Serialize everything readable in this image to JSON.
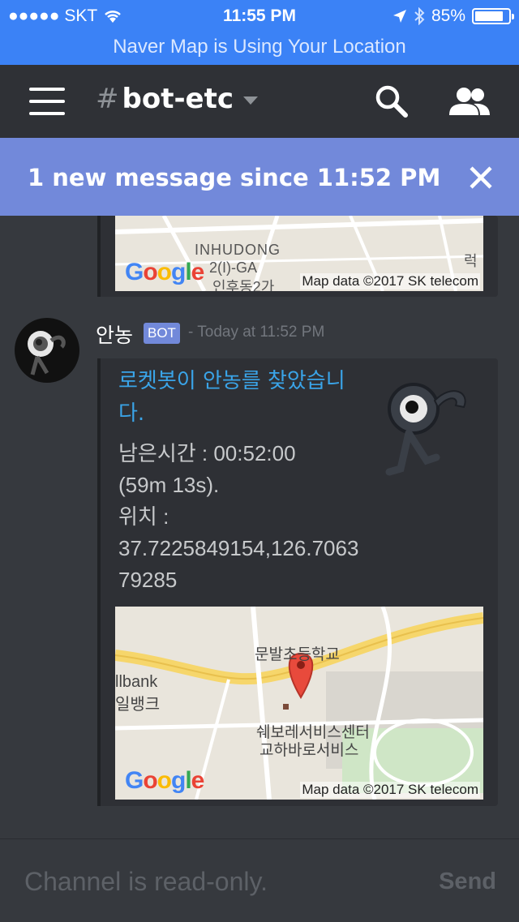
{
  "status_bar": {
    "carrier": "SKT",
    "time": "11:55 PM",
    "battery_percent": "85%",
    "battery_level": 0.85,
    "location_banner": "Naver Map is Using Your Location"
  },
  "header": {
    "channel_name": "bot-etc",
    "hash": "#"
  },
  "new_messages_bar": {
    "text": "1 new message since 11:52 PM"
  },
  "previous_embed": {
    "map_labels": [
      "INHUDONG",
      "2(I)-GA",
      "인후동2가",
      "럭"
    ],
    "google_logo": [
      "G",
      "o",
      "o",
      "g",
      "l",
      "e"
    ],
    "map_credit": "Map data ©2017 SK telecom"
  },
  "message": {
    "author": "안농",
    "badge": "BOT",
    "timestamp": "- Today at 11:52 PM",
    "embed": {
      "title": "로켓봇이 안농를 찾았습니다.",
      "description_lines": [
        "남은시간 : 00:52:00",
        "(59m 13s).",
        "위치 :",
        "37.7225849154,126.706379285"
      ],
      "map_labels": [
        "문발초등학교",
        "llbank",
        "일뱅크",
        "쉐보레서비스센터",
        "교하바로서비스"
      ],
      "google_logo": [
        "G",
        "o",
        "o",
        "g",
        "l",
        "e"
      ],
      "map_credit": "Map data ©2017 SK telecom"
    }
  },
  "composer": {
    "placeholder": "Channel is read-only.",
    "send_label": "Send"
  },
  "colors": {
    "status_bar": "#3b82f6",
    "new_messages_bar": "#7289da",
    "embed_title": "#3aa4e8",
    "background": "#36393e"
  }
}
